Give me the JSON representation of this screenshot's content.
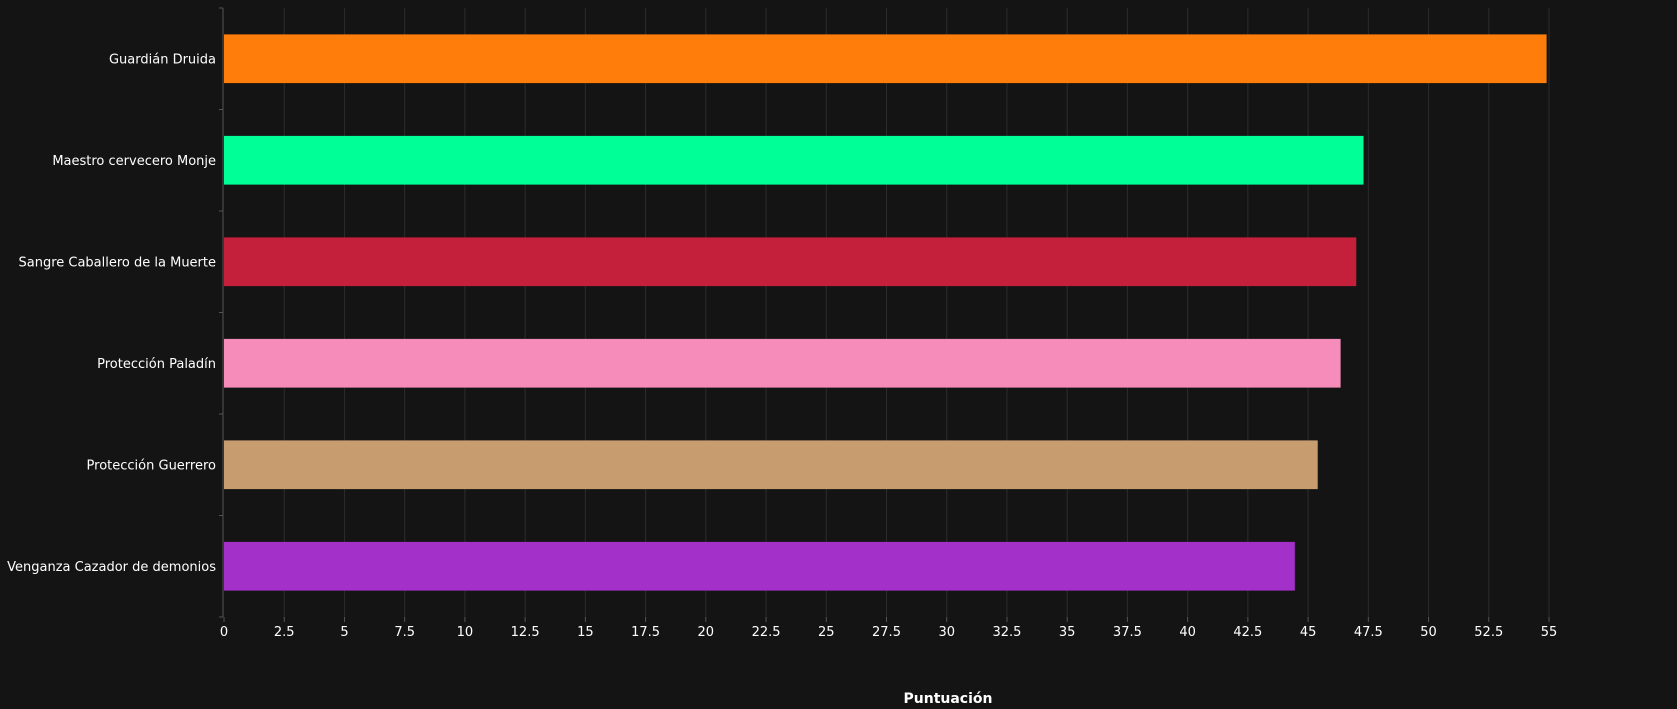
{
  "chart_data": {
    "type": "bar",
    "orientation": "horizontal",
    "categories": [
      "Guardián Druida",
      "Maestro cervecero Monje",
      "Sangre Caballero de la Muerte",
      "Protección Paladín",
      "Protección Guerrero",
      "Venganza Cazador de demonios"
    ],
    "values": [
      54.9,
      47.3,
      47.0,
      46.35,
      45.4,
      44.45
    ],
    "colors": [
      "#ff7d0a",
      "#00ff96",
      "#c41f3b",
      "#f58cba",
      "#c79c6e",
      "#a330c9"
    ],
    "xlabel": "Puntuación",
    "xlim": [
      0,
      55
    ],
    "xticks": [
      "0",
      "2.5",
      "5",
      "7.5",
      "10",
      "12.5",
      "15",
      "17.5",
      "20",
      "22.5",
      "25",
      "27.5",
      "30",
      "32.5",
      "35",
      "37.5",
      "40",
      "42.5",
      "45",
      "47.5",
      "50",
      "52.5",
      "55"
    ],
    "grid": true,
    "background": "#141414"
  }
}
